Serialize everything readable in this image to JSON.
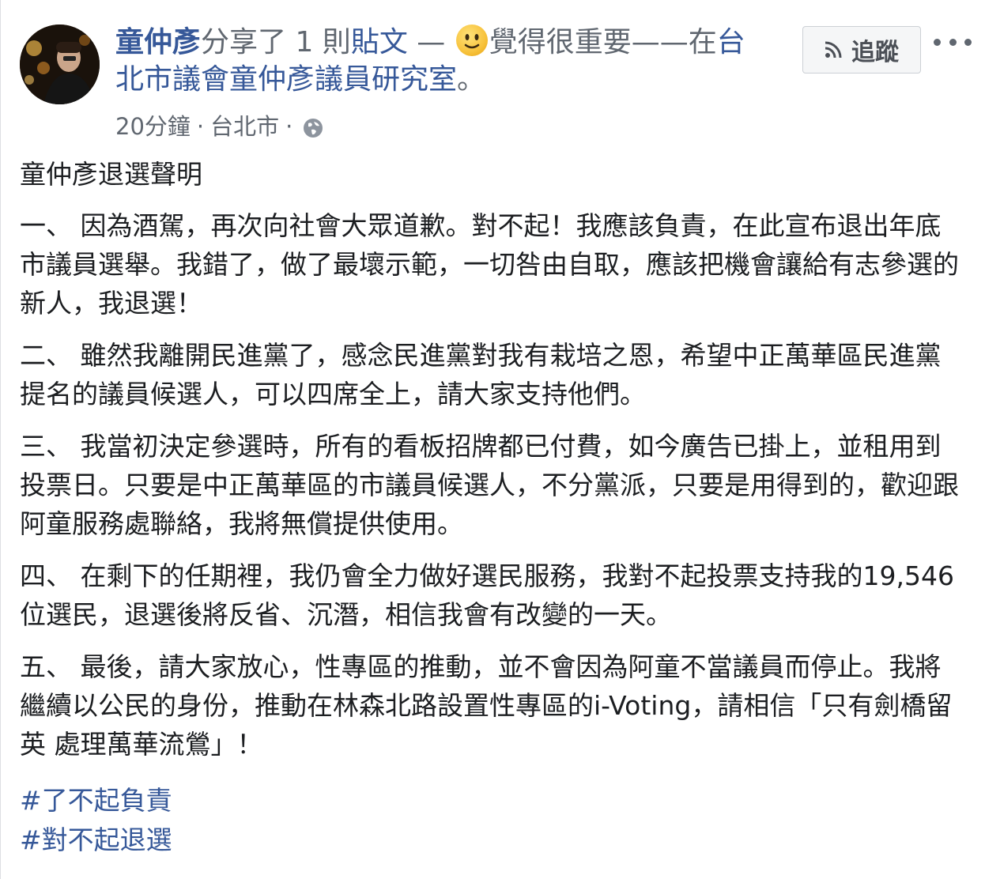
{
  "post": {
    "author": "童仲彥",
    "shared_text": "分享了 1 則",
    "post_link": "貼文",
    "dash": " — ",
    "feeling": "覺得很重要",
    "location_prefix": "——在",
    "location_page_1": "台",
    "location_page_2": "北市議會童仲彥議員研究室",
    "period": "。",
    "time": "20分鐘",
    "place": "台北市",
    "separator": "·",
    "privacy_icon": "globe-icon",
    "emoji_icon": "slightly-smiling-face-icon"
  },
  "follow_button": {
    "label": "追蹤",
    "icon": "rss-icon"
  },
  "more_button": {
    "icon": "more-dots-icon"
  },
  "content": {
    "title": "童仲彥退選聲明",
    "paragraphs": [
      "一、 因為酒駕，再次向社會大眾道歉。對不起！我應該負責，在此宣布退出年底市議員選舉。我錯了，做了最壞示範，一切咎由自取，應該把機會讓給有志參選的新人，我退選！",
      "二、 雖然我離開民進黨了，感念民進黨對我有栽培之恩，希望中正萬華區民進黨提名的議員候選人，可以四席全上，請大家支持他們。",
      "三、 我當初決定參選時，所有的看板招牌都已付費，如今廣告已掛上，並租用到投票日。只要是中正萬華區的市議員候選人，不分黨派，只要是用得到的，歡迎跟阿童服務處聯絡，我將無償提供使用。",
      "四、 在剩下的任期裡，我仍會全力做好選民服務，我對不起投票支持我的19,546位選民，退選後將反省、沉潛，相信我會有改變的一天。",
      "五、 最後，請大家放心，性專區的推動，並不會因為阿童不當議員而停止。我將繼續以公民的身份，推動在林森北路設置性專區的i-Voting，請相信「只有劍橋留英 處理萬華流鶯」！"
    ],
    "hashtags": [
      "#了不起負責",
      "#對不起退選"
    ]
  }
}
